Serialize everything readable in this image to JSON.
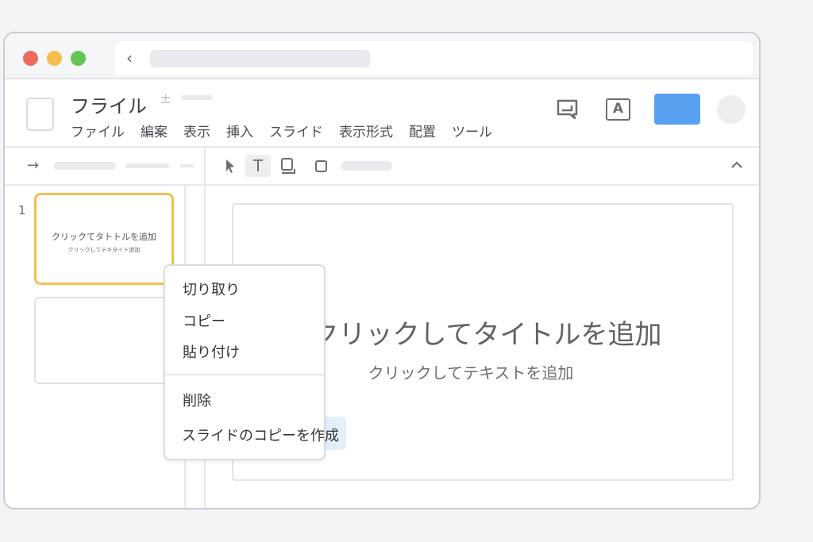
{
  "window": {
    "traffic_lights": {
      "close": "#ee6a5f",
      "minimize": "#f5be4f",
      "maximize": "#62c554"
    }
  },
  "header": {
    "doc_title": "フライル",
    "menu": [
      "ファイル",
      "編案",
      "表示",
      "挿入",
      "スライド",
      "表示形式",
      "配置",
      "ツール"
    ],
    "share_color": "#58a0f0"
  },
  "sidebar": {
    "slide_number": "1",
    "thumb_title": "クリックてタトトルを追加",
    "thumb_subtitle": "クリックしてテキタイト追加",
    "selected_color": "#f2c14e"
  },
  "slide": {
    "title": "クリックしてタイトルを追加",
    "subtitle": "クリックしてテキストを追加"
  },
  "context_menu": {
    "items": [
      "切り取り",
      "コピー",
      "貼り付け",
      "削除",
      "スライドのコピーを作成"
    ],
    "highlighted": "スライドのコピーを作成"
  }
}
